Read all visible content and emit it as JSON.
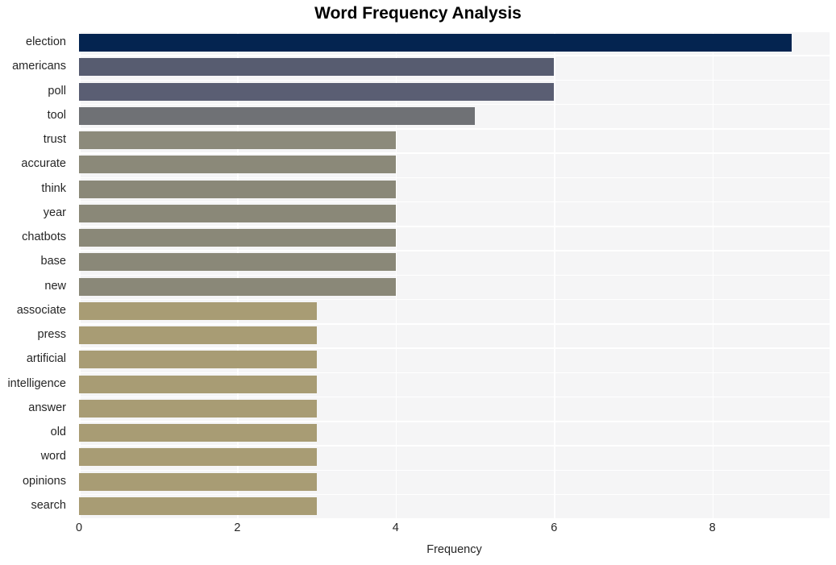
{
  "chart": {
    "title": "Word Frequency Analysis",
    "xlabel": "Frequency",
    "ylabel": ""
  },
  "axis": {
    "xticks": [
      "0",
      "2",
      "4",
      "6",
      "8"
    ],
    "xtick_values": [
      0,
      2,
      4,
      6,
      8
    ]
  },
  "chart_data": {
    "type": "bar",
    "orientation": "horizontal",
    "title": "Word Frequency Analysis",
    "xlabel": "Frequency",
    "ylabel": "",
    "categories": [
      "election",
      "americans",
      "poll",
      "tool",
      "trust",
      "accurate",
      "think",
      "year",
      "chatbots",
      "base",
      "new",
      "associate",
      "press",
      "artificial",
      "intelligence",
      "answer",
      "old",
      "word",
      "opinions",
      "search"
    ],
    "values": [
      9,
      6,
      6,
      5,
      4,
      4,
      4,
      4,
      4,
      4,
      4,
      3,
      3,
      3,
      3,
      3,
      3,
      3,
      3,
      3
    ],
    "colors": [
      "#042450",
      "#575c70",
      "#5a5e73",
      "#6f7175",
      "#8c8a7b",
      "#8b8979",
      "#8a8878",
      "#8a8878",
      "#8a8878",
      "#8a8878",
      "#8a8878",
      "#a89c74",
      "#a89c74",
      "#a89c74",
      "#a89c74",
      "#a89c74",
      "#a89c74",
      "#a89c74",
      "#a89c74",
      "#a89c74"
    ],
    "xlim": [
      0,
      9.48
    ],
    "grid": true,
    "gridcolor": "#ffffff",
    "plot_background": "#f5f5f6",
    "figure_background": "#ffffff",
    "legend": null
  }
}
